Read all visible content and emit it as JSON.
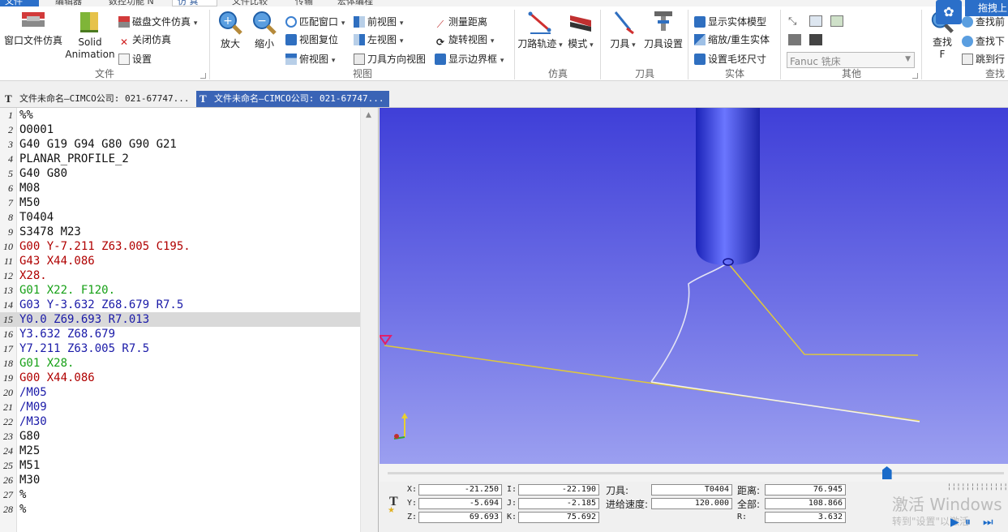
{
  "tabs": {
    "file": "文件",
    "edit": "编辑器",
    "numeric": "数控功能 N",
    "sim": "仿 真",
    "compare": "文件比较",
    "transfer": "传输",
    "macro": "宏体编程"
  },
  "ribbon": {
    "file_group": {
      "label": "文件",
      "window_sim": "窗口文件仿真",
      "solid_anim_1": "Solid",
      "solid_anim_2": "Animation",
      "disk_sim": "磁盘文件仿真",
      "close_sim": "关闭仿真",
      "settings": "设置"
    },
    "view_group": {
      "label": "视图",
      "zoom_in": "放大",
      "zoom_out": "缩小",
      "fit_window": "匹配窗口",
      "view_reset": "视图复位",
      "top_view": "俯视图",
      "front_view": "前视图",
      "left_view": "左视图",
      "tool_dir_view": "刀具方向视图",
      "measure": "测量距离",
      "rotate_view": "旋转视图",
      "show_bbox": "显示边界框"
    },
    "sim_group": {
      "label": "仿真",
      "toolpath": "刀路轨迹",
      "mode": "模式"
    },
    "tool_group": {
      "label": "刀具",
      "tool": "刀具",
      "tool_setup": "刀具设置"
    },
    "solid_group": {
      "label": "实体",
      "show_solid": "显示实体模型",
      "rebuild": "缩放/重生实体",
      "stock_size": "设置毛坯尺寸"
    },
    "other_group": {
      "label": "其他",
      "machine_select": "Fanuc 铣床"
    },
    "search_group": {
      "label": "查找",
      "find": "查找",
      "find_key": "F",
      "find_prev": "查找前",
      "find_next": "查找下",
      "goto_line": "跳到行",
      "drag_up": "拖拽上"
    }
  },
  "doc_tabs": [
    "文件未命名—CIMCO公司: 021-67747...",
    "文件未命名—CIMCO公司: 021-67747..."
  ],
  "code_lines": [
    {
      "n": "1",
      "t": "%%",
      "c": "#111111"
    },
    {
      "n": "2",
      "t": "O0001",
      "c": "#111111"
    },
    {
      "n": "3",
      "t": "G40 G19 G94 G80 G90 G21",
      "c": "#111111"
    },
    {
      "n": "4",
      "t": "PLANAR_PROFILE_2",
      "c": "#111111"
    },
    {
      "n": "5",
      "t": "G40 G80",
      "c": "#111111"
    },
    {
      "n": "6",
      "t": "M08",
      "c": "#111111"
    },
    {
      "n": "7",
      "t": "M50",
      "c": "#111111"
    },
    {
      "n": "8",
      "t": "T0404",
      "c": "#111111"
    },
    {
      "n": "9",
      "t": "S3478 M23",
      "c": "#111111"
    },
    {
      "n": "10",
      "t": "G00 Y-7.211 Z63.005 C195.",
      "c": "#b00000"
    },
    {
      "n": "11",
      "t": "G43 X44.086",
      "c": "#b00000"
    },
    {
      "n": "12",
      "t": "X28.",
      "c": "#b00000"
    },
    {
      "n": "13",
      "t": "G01 X22. F120.",
      "c": "#16a016"
    },
    {
      "n": "14",
      "t": "G03 Y-3.632 Z68.679 R7.5",
      "c": "#1a1aa8"
    },
    {
      "n": "15",
      "t": "Y0.0 Z69.693 R7.013",
      "c": "#1a1aa8"
    },
    {
      "n": "16",
      "t": "Y3.632 Z68.679",
      "c": "#1a1aa8"
    },
    {
      "n": "17",
      "t": "Y7.211 Z63.005 R7.5",
      "c": "#1a1aa8"
    },
    {
      "n": "18",
      "t": "G01 X28.",
      "c": "#16a016"
    },
    {
      "n": "19",
      "t": "G00 X44.086",
      "c": "#b00000"
    },
    {
      "n": "20",
      "t": "/M05",
      "c": "#1a1aa8"
    },
    {
      "n": "21",
      "t": "/M09",
      "c": "#1a1aa8"
    },
    {
      "n": "22",
      "t": "/M30",
      "c": "#1a1aa8"
    },
    {
      "n": "23",
      "t": "G80",
      "c": "#111111"
    },
    {
      "n": "24",
      "t": "M25",
      "c": "#111111"
    },
    {
      "n": "25",
      "t": "M51",
      "c": "#111111"
    },
    {
      "n": "26",
      "t": "M30",
      "c": "#111111"
    },
    {
      "n": "27",
      "t": "%",
      "c": "#111111"
    },
    {
      "n": "28",
      "t": "%",
      "c": "#111111"
    }
  ],
  "selected_line": 15,
  "readout": {
    "x_lbl": "X:",
    "x": "-21.250",
    "y_lbl": "Y:",
    "y": "-5.694",
    "z_lbl": "Z:",
    "z": "69.693",
    "i_lbl": "I:",
    "i": "-22.190",
    "j_lbl": "J:",
    "j": "-2.185",
    "k_lbl": "K:",
    "k": "75.692",
    "tool_lbl": "刀具:",
    "tool": "T0404",
    "feed_lbl": "进给速度:",
    "feed": "120.000",
    "dist_lbl": "距离:",
    "dist": "76.945",
    "total_lbl": "全部:",
    "total": "108.866",
    "r_lbl": "R:",
    "r": "3.632"
  },
  "watermark": {
    "line1": "激活 Windows",
    "line2": "转到\"设置\"以激活"
  },
  "playback_progress": 0.81
}
